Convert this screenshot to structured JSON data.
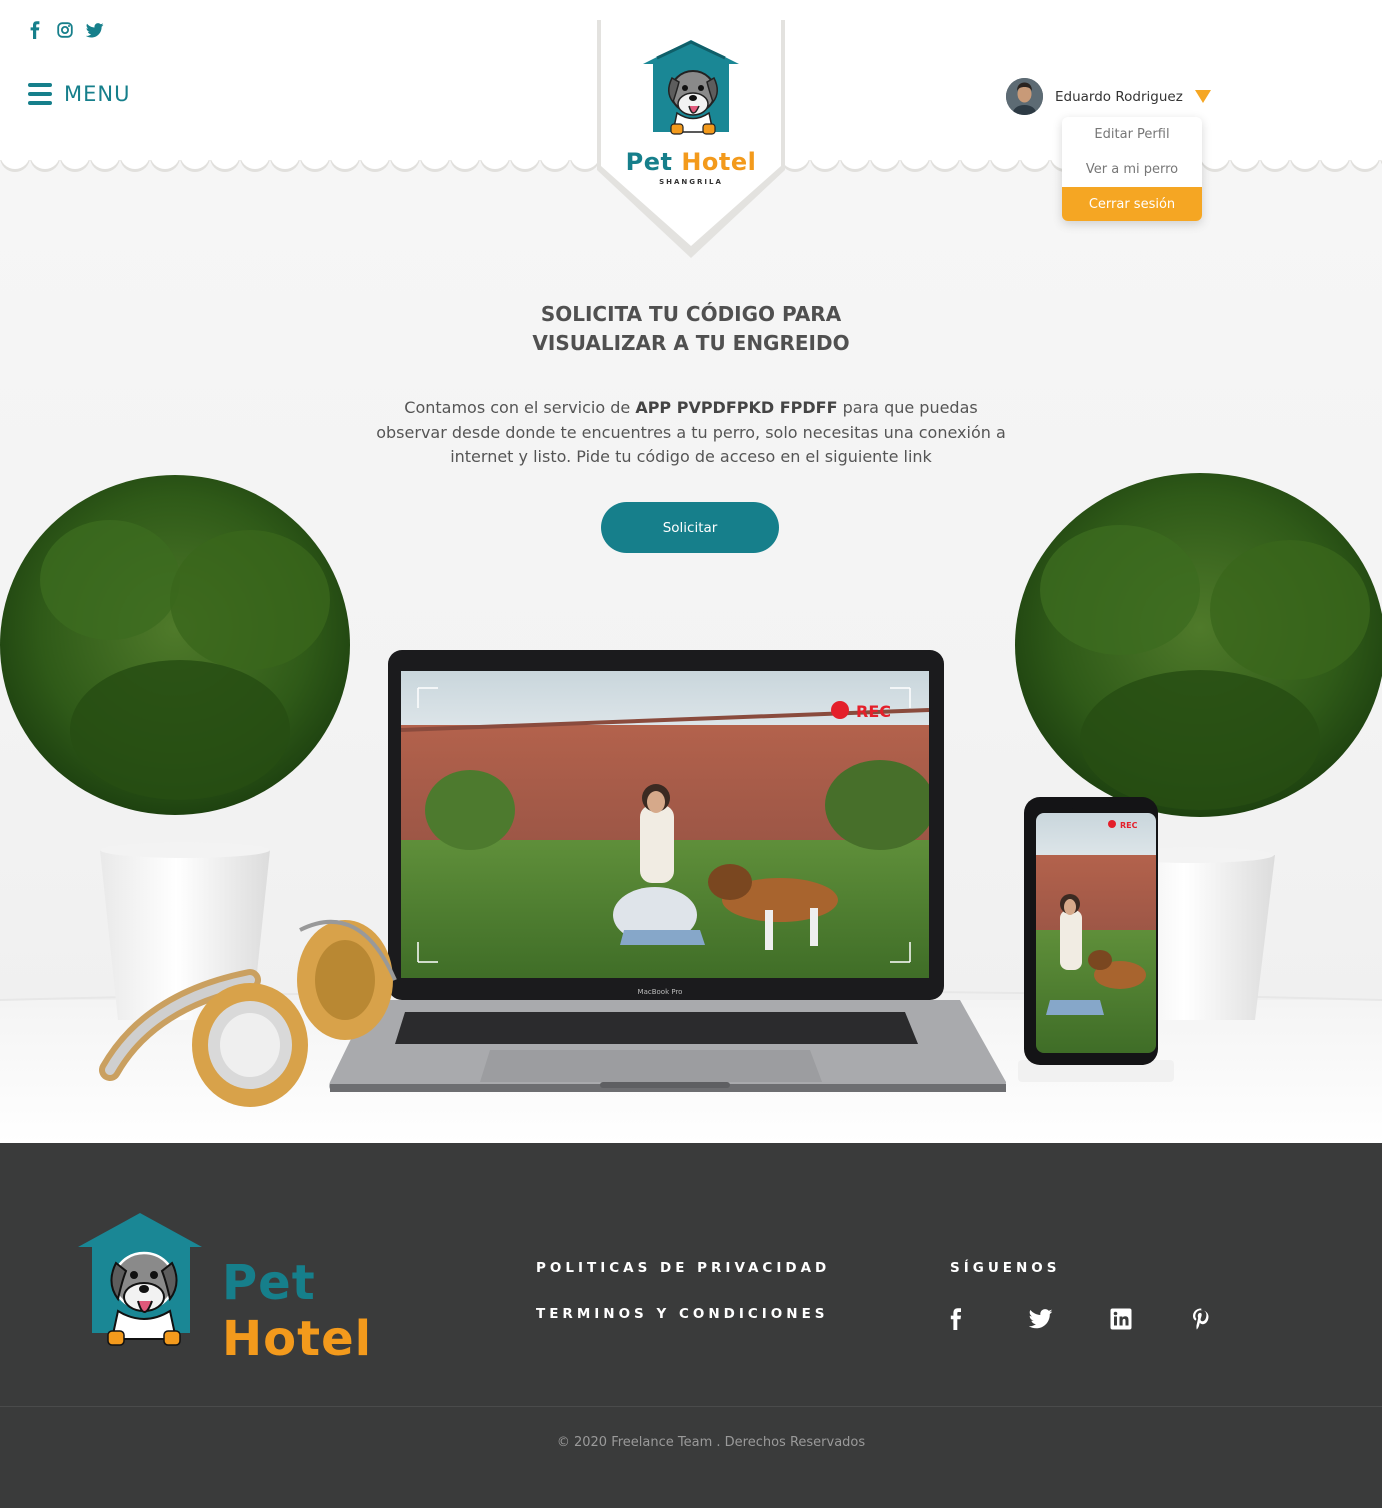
{
  "header": {
    "social_icons": [
      "facebook-icon",
      "instagram-icon",
      "twitter-icon"
    ],
    "menu_label": "MENU",
    "logo": {
      "word_pet": "Pet",
      "word_hotel": "Hotel",
      "subtitle": "SHANGRILA"
    },
    "user": {
      "name": "Eduardo Rodriguez",
      "dropdown": [
        "Editar Perfil",
        "Ver a mi perro",
        "Cerrar sesión"
      ],
      "active_item": "Cerrar sesión"
    }
  },
  "hero": {
    "title_line1": "SOLICITA TU CÓDIGO PARA",
    "title_line2": "VISUALIZAR A TU ENGREIDO",
    "text_before": "Contamos con el servicio de ",
    "text_bold": "APP PVPDFPKD FPDFF",
    "text_after": " para que puedas observar desde donde te encuentres a tu perro, solo necesitas una conexión a internet y listo. Pide tu código de acceso en el siguiente link",
    "button_label": "Solicitar",
    "laptop_brand": "MacBook Pro",
    "rec_label": "REC"
  },
  "footer": {
    "logo": {
      "word_pet": "Pet",
      "word_hotel": "Hotel"
    },
    "links": [
      "POLITICAS DE PRIVACIDAD",
      "TERMINOS Y CONDICIONES"
    ],
    "follow_title": "SÍGUENOS",
    "social_icons": [
      "facebook-icon",
      "twitter-icon",
      "linkedin-icon",
      "pinterest-icon"
    ],
    "copyright": "© 2020 Freelance Team . Derechos Reservados"
  },
  "colors": {
    "brand_teal": "#167f8b",
    "brand_orange": "#f39a1c",
    "accent": "#f5a623",
    "footer_bg": "#3a3b3b"
  }
}
